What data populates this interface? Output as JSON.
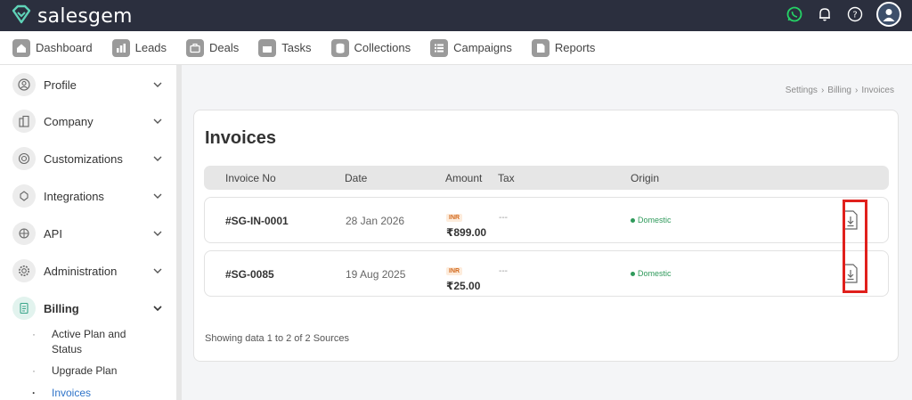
{
  "brand": {
    "name": "salesgem"
  },
  "topbar": {
    "icons": [
      "whatsapp-icon",
      "bell-icon",
      "help-icon",
      "user-avatar-icon"
    ]
  },
  "nav": {
    "items": [
      {
        "label": "Dashboard",
        "icon": "home-icon"
      },
      {
        "label": "Leads",
        "icon": "leads-chart-icon"
      },
      {
        "label": "Deals",
        "icon": "briefcase-icon"
      },
      {
        "label": "Tasks",
        "icon": "tasks-icon"
      },
      {
        "label": "Collections",
        "icon": "database-icon"
      },
      {
        "label": "Campaigns",
        "icon": "list-icon"
      },
      {
        "label": "Reports",
        "icon": "document-icon"
      }
    ]
  },
  "sidebar": {
    "items": [
      {
        "label": "Profile",
        "icon": "profile-icon"
      },
      {
        "label": "Company",
        "icon": "company-icon"
      },
      {
        "label": "Customizations",
        "icon": "customizations-icon"
      },
      {
        "label": "Integrations",
        "icon": "integrations-icon"
      },
      {
        "label": "API",
        "icon": "api-icon"
      },
      {
        "label": "Administration",
        "icon": "gear-icon"
      },
      {
        "label": "Billing",
        "icon": "billing-icon"
      }
    ],
    "billing_sub": [
      {
        "label_line1": "Active Plan and",
        "label_line2": "Status"
      },
      {
        "label_line1": "Upgrade Plan"
      },
      {
        "label_line1": "Invoices"
      }
    ]
  },
  "breadcrumb": {
    "parts": [
      "Settings",
      "Billing",
      "Invoices"
    ],
    "sep": "›"
  },
  "invoices": {
    "title": "Invoices",
    "columns": {
      "invoice_no": "Invoice No",
      "date": "Date",
      "amount": "Amount",
      "tax": "Tax",
      "origin": "Origin"
    },
    "rows": [
      {
        "invoice_no": "#SG-IN-0001",
        "date": "28 Jan 2026",
        "currency": "INR",
        "amount": "₹899.00",
        "tax": "---",
        "origin": "Domestic"
      },
      {
        "invoice_no": "#SG-0085",
        "date": "19 Aug 2025",
        "currency": "INR",
        "amount": "₹25.00",
        "tax": "---",
        "origin": "Domestic"
      }
    ],
    "footer": "Showing data 1 to 2 of 2 Sources"
  },
  "colors": {
    "topbar": "#2b2f3e",
    "highlight": "#e0201c",
    "origin_green": "#2f9a5b",
    "active_link": "#2f74c9",
    "whatsapp": "#25d366"
  }
}
